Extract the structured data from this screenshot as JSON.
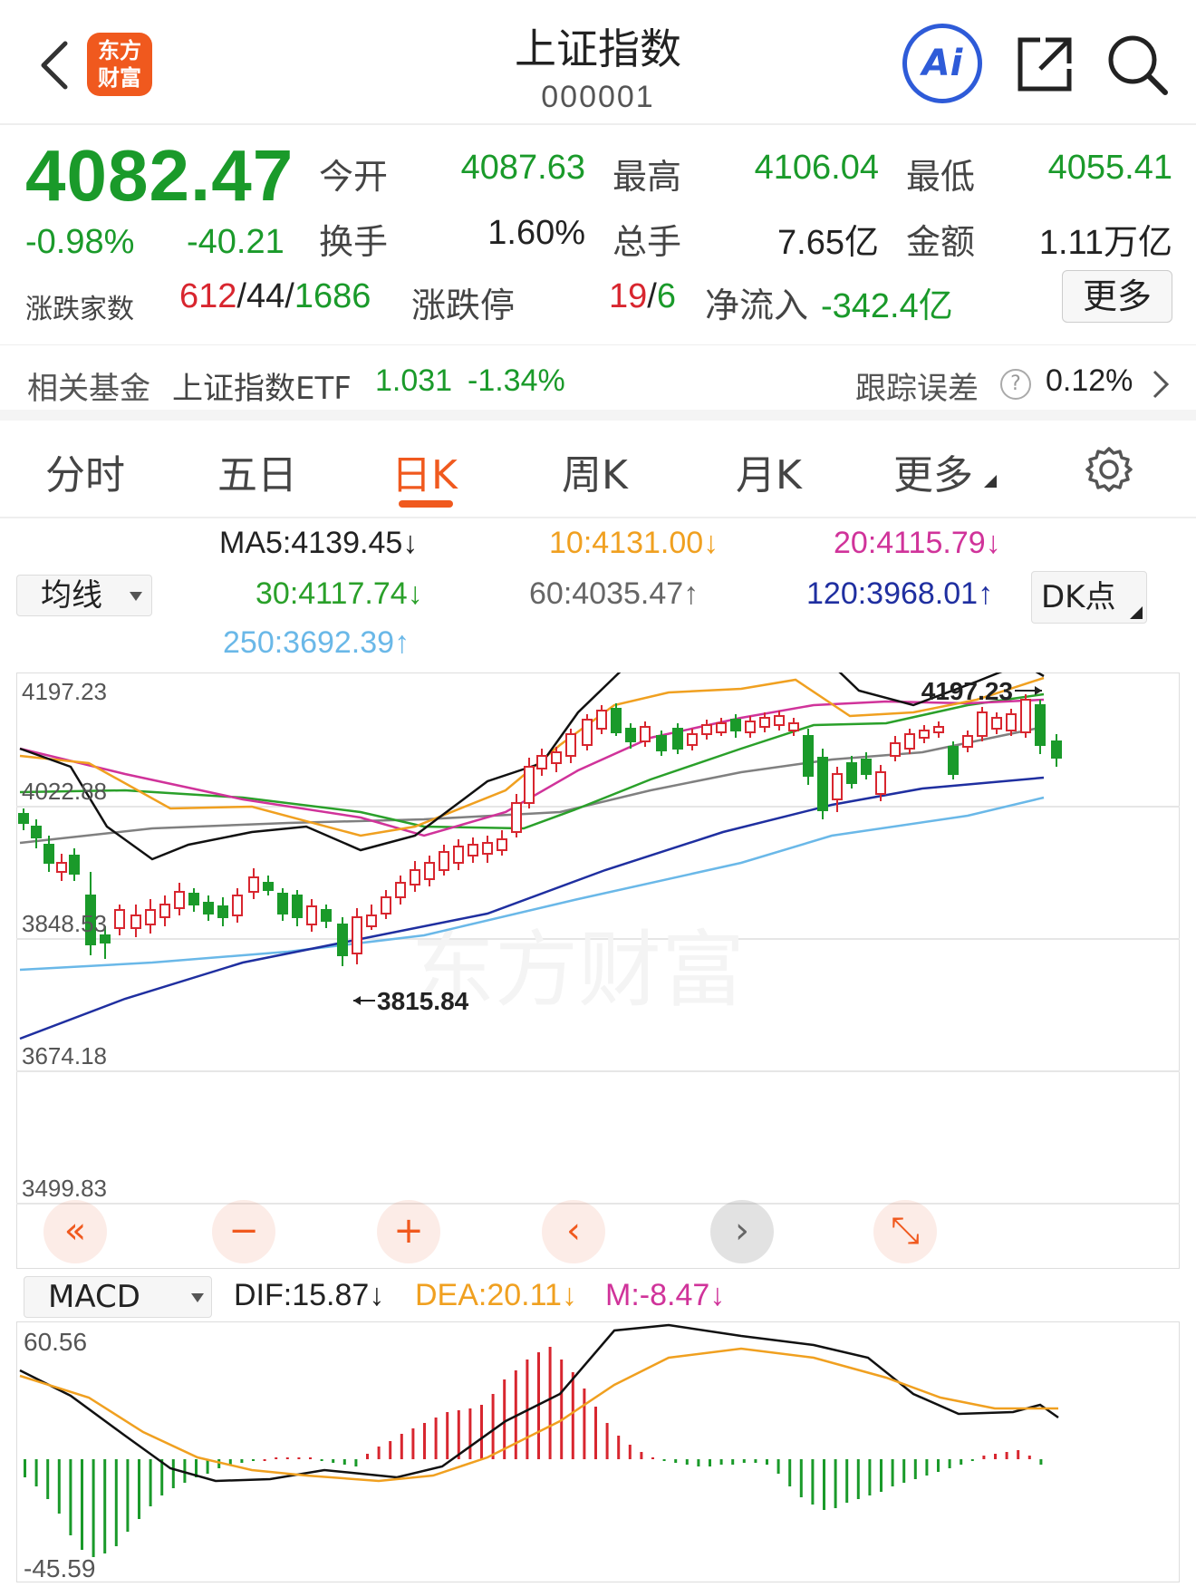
{
  "header": {
    "logo_line1": "东方",
    "logo_line2": "财富",
    "title": "上证指数",
    "code": "000001",
    "ai_label": "Ai"
  },
  "quote": {
    "price": "4082.47",
    "change_pct": "-0.98%",
    "change": "-40.21",
    "open_label": "今开",
    "open": "4087.63",
    "high_label": "最高",
    "high": "4106.04",
    "low_label": "最低",
    "low": "4055.41",
    "turnover_label": "换手",
    "turnover": "1.60%",
    "volume_label": "总手",
    "volume": "7.65亿",
    "amount_label": "金额",
    "amount": "1.11万亿",
    "breadth_label": "涨跌家数",
    "breadth_up": "612",
    "breadth_sep1": "/",
    "breadth_flat": "44",
    "breadth_sep2": "/",
    "breadth_down": "1686",
    "limit_label": "涨跌停",
    "limit_up": "19",
    "limit_sep": "/",
    "limit_down": "6",
    "netflow_label": "净流入",
    "netflow": "-342.4亿",
    "more": "更多"
  },
  "fund": {
    "label": "相关基金",
    "name": "上证指数ETF",
    "price": "1.031",
    "change": "-1.34%",
    "tracking_label": "跟踪误差",
    "help": "?",
    "tracking_value": "0.12%"
  },
  "tabs": [
    {
      "label": "分时"
    },
    {
      "label": "五日"
    },
    {
      "label": "日K"
    },
    {
      "label": "周K"
    },
    {
      "label": "月K"
    },
    {
      "label": "更多"
    }
  ],
  "ma_legend": {
    "dropdown": "均线",
    "ma5": "MA5:4139.45↓",
    "ma10": "10:4131.00↓",
    "ma20": "20:4115.79↓",
    "ma30": "30:4117.74↓",
    "ma60": "60:4035.47↑",
    "ma120": "120:3968.01↑",
    "ma250": "250:3692.39↑",
    "dk": "DK点"
  },
  "colors": {
    "up": "#d8262f",
    "down": "#1a9a2a",
    "ma5": "#111111",
    "ma10": "#f0a020",
    "ma20": "#d0339a",
    "ma30": "#2aa02a",
    "ma60": "#808080",
    "ma120": "#1f2fa0",
    "ma250": "#6ab8e8",
    "accent": "#f0591e"
  },
  "kchart": {
    "y_labels": [
      "4197.23",
      "4022.88",
      "3848.53",
      "3674.18",
      "3499.83"
    ],
    "high_marker": "4197.23",
    "low_marker": "3815.84",
    "watermark": "东方财富"
  },
  "controls": {
    "first": "«",
    "zoom_out": "−",
    "zoom_in": "+",
    "prev": "‹",
    "next": "›",
    "expand": "⤡"
  },
  "macd": {
    "dropdown": "MACD",
    "dif": "DIF:15.87↓",
    "dea": "DEA:20.11↓",
    "m": "M:-8.47↓",
    "y_top": "60.56",
    "y_bottom": "-45.59"
  }
}
